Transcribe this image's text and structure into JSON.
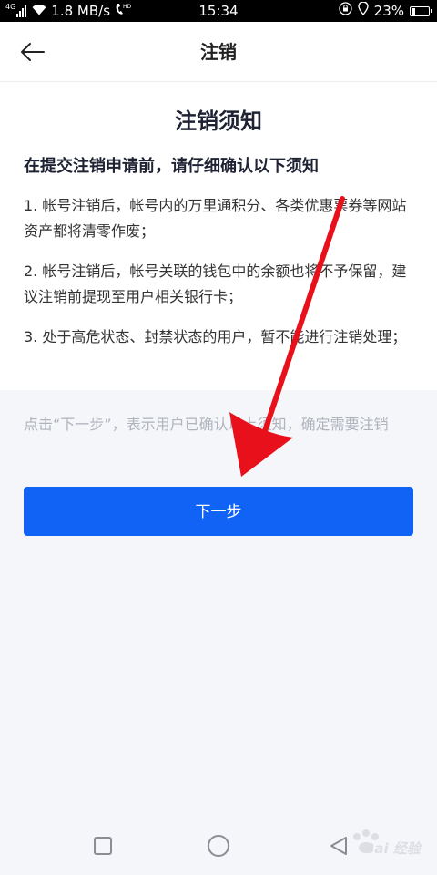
{
  "status_bar": {
    "network_label": "4G",
    "speed": "1.8 MB/s",
    "hd_label": "HD",
    "time": "15:34",
    "battery": "23%",
    "battery_level": 0.23
  },
  "header": {
    "title": "注销",
    "back_icon": "arrow-left-icon"
  },
  "notice": {
    "title": "注销须知",
    "subtitle": "在提交注销申请前，请仔细确认以下须知",
    "items": [
      "1. 帐号注销后，帐号内的万里通积分、各类优惠票券等网站资产都将清零作废；",
      "2. 帐号注销后，帐号关联的钱包中的余额也将不予保留，建议注销前提现至用户相关银行卡；",
      "3. 处于高危状态、封禁状态的用户，暂不能进行注销处理；"
    ]
  },
  "confirm": {
    "hint": "点击“下一步”，表示用户已确认以上须知，确定需要注销",
    "next_button": "下一步"
  },
  "colors": {
    "accent": "#1063f5",
    "annotation_arrow": "#e8101a"
  },
  "nav_bar": {
    "recent_icon": "square-icon",
    "home_icon": "circle-icon",
    "back_icon": "triangle-back-icon"
  },
  "watermark": {
    "text": "Bai 经验"
  }
}
